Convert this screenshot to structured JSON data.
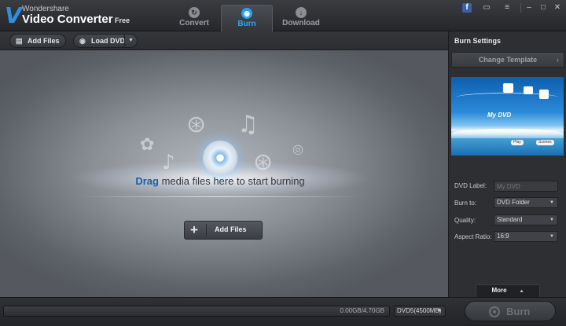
{
  "app": {
    "brand": "Wondershare",
    "product": "Video Converter",
    "edition": "Free"
  },
  "tabs": [
    {
      "label": "Convert",
      "icon": "convert-icon"
    },
    {
      "label": "Burn",
      "icon": "burn-icon",
      "active": true
    },
    {
      "label": "Download",
      "icon": "download-icon"
    }
  ],
  "window_controls": [
    "facebook-icon",
    "chat-icon",
    "list-icon",
    "minimize-icon",
    "maximize-icon",
    "close-icon"
  ],
  "toolbar": {
    "add_files": "Add Files",
    "load_dvd": "Load DVD"
  },
  "main": {
    "drag_bold": "Drag",
    "drag_rest": " media files here to start burning",
    "add_files": "Add Files"
  },
  "burn_settings": {
    "title": "Burn Settings",
    "change_template": "Change Template",
    "preview": {
      "title": "My DVD",
      "play": "Play",
      "scenes": "Scenes"
    },
    "dvd_label": {
      "label": "DVD Label:",
      "placeholder": "My DVD"
    },
    "burn_to": {
      "label": "Burn to:",
      "value": "DVD Folder"
    },
    "quality": {
      "label": "Quality:",
      "value": "Standard"
    },
    "aspect_ratio": {
      "label": "Aspect Ratio:",
      "value": "16:9"
    },
    "more": "More"
  },
  "bottom": {
    "usage": "0.00GB/4.70GB",
    "usage_fraction": 0,
    "disc_type": "DVD5(4500MB)",
    "burn": "Burn"
  },
  "colors": {
    "accent": "#2aa0ec",
    "background": "#2a2c30"
  }
}
